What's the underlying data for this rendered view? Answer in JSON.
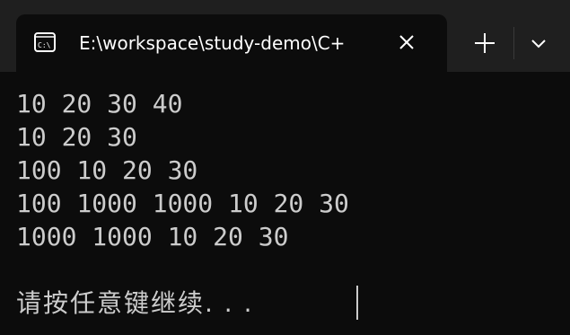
{
  "tab": {
    "title": "E:\\workspace\\study-demo\\C+",
    "icon": "terminal-icon"
  },
  "toolbar": {
    "new_tab_icon": "plus-icon",
    "dropdown_icon": "chevron-down-icon",
    "close_icon": "close-icon"
  },
  "console": {
    "lines": [
      "10 20 30 40",
      "10 20 30",
      "100 10 20 30",
      "100 1000 1000 10 20 30",
      "1000 1000 10 20 30"
    ],
    "prompt": "请按任意键继续. . ."
  },
  "colors": {
    "background": "#0c0c0c",
    "titlebar": "#1f1f1f",
    "text": "#cccccc",
    "title_text": "#ffffff"
  }
}
